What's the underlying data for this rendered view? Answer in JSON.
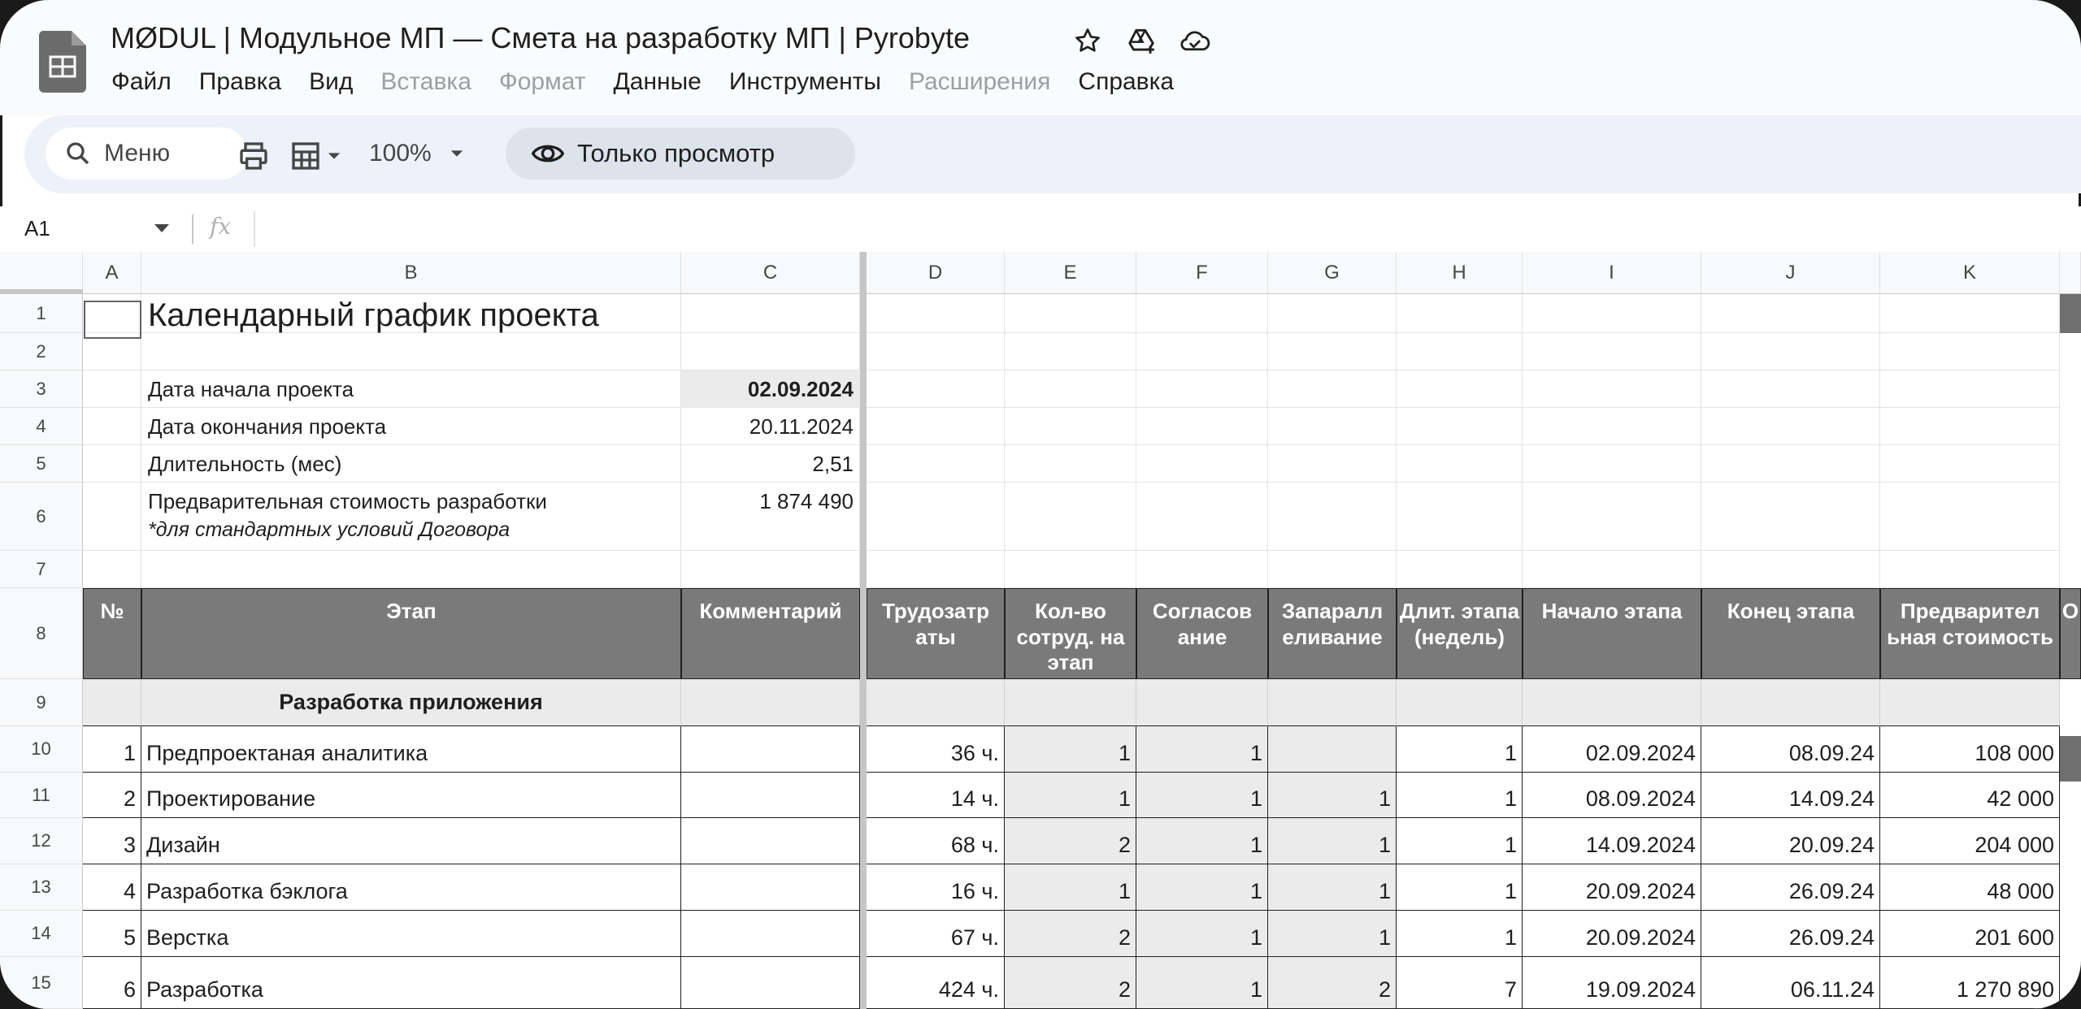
{
  "header": {
    "doc_title": "MØDUL | Модульное МП — Смета на разработку МП | Pyrobyte",
    "menu": [
      {
        "label": "Файл",
        "disabled": false
      },
      {
        "label": "Правка",
        "disabled": false
      },
      {
        "label": "Вид",
        "disabled": false
      },
      {
        "label": "Вставка",
        "disabled": true
      },
      {
        "label": "Формат",
        "disabled": true
      },
      {
        "label": "Данные",
        "disabled": false
      },
      {
        "label": "Инструменты",
        "disabled": false
      },
      {
        "label": "Расширения",
        "disabled": true
      },
      {
        "label": "Справка",
        "disabled": false
      }
    ]
  },
  "toolbar": {
    "search_label": "Меню",
    "zoom": "100%",
    "view_mode": "Только просмотр"
  },
  "formula_bar": {
    "cell_ref": "A1",
    "fx": "fx",
    "value": ""
  },
  "columns": [
    "A",
    "B",
    "C",
    "D",
    "E",
    "F",
    "G",
    "H",
    "I",
    "J",
    "K"
  ],
  "rows": [
    "1",
    "2",
    "3",
    "4",
    "5",
    "6",
    "7",
    "8",
    "9",
    "10",
    "11",
    "12",
    "13",
    "14",
    "15"
  ],
  "sheet": {
    "title": "Календарный график проекта",
    "info": [
      {
        "label": "Дата начала проекта",
        "value": "02.09.2024"
      },
      {
        "label": "Дата окончания проекта",
        "value": "20.11.2024"
      },
      {
        "label": "Длительность (мес)",
        "value": "2,51"
      },
      {
        "label": "Предварительная стоимость разработки",
        "value": "1 874 490"
      }
    ],
    "info_note": "*для стандартных условий Договора",
    "table_headers": {
      "num": "№",
      "stage": "Этап",
      "comment": "Комментарий",
      "labor": "Трудозатр аты",
      "staff": "Кол-во сотруд. на этап",
      "approval": "Согласов ание",
      "parallel": "Запаралл еливание",
      "duration": "Длит. этапа (недель)",
      "start": "Начало этапа",
      "end": "Конец этапа",
      "cost": "Предварител ьная стоимость",
      "next": "О"
    },
    "section_title": "Разработка приложения",
    "stages": [
      {
        "n": "1",
        "name": "Предпроектаная аналитика",
        "labor": "36 ч.",
        "staff": "1",
        "approval": "1",
        "parallel": "",
        "duration": "1",
        "start": "02.09.2024",
        "end": "08.09.24",
        "cost": "108 000"
      },
      {
        "n": "2",
        "name": "Проектирование",
        "labor": "14 ч.",
        "staff": "1",
        "approval": "1",
        "parallel": "1",
        "duration": "1",
        "start": "08.09.2024",
        "end": "14.09.24",
        "cost": "42 000"
      },
      {
        "n": "3",
        "name": "Дизайн",
        "labor": "68 ч.",
        "staff": "2",
        "approval": "1",
        "parallel": "1",
        "duration": "1",
        "start": "14.09.2024",
        "end": "20.09.24",
        "cost": "204 000"
      },
      {
        "n": "4",
        "name": "Разработка бэклога",
        "labor": "16 ч.",
        "staff": "1",
        "approval": "1",
        "parallel": "1",
        "duration": "1",
        "start": "20.09.2024",
        "end": "26.09.24",
        "cost": "48 000"
      },
      {
        "n": "5",
        "name": "Верстка",
        "labor": "67 ч.",
        "staff": "2",
        "approval": "1",
        "parallel": "1",
        "duration": "1",
        "start": "20.09.2024",
        "end": "26.09.24",
        "cost": "201 600"
      },
      {
        "n": "6",
        "name": "Разработка",
        "labor": "424 ч.",
        "staff": "2",
        "approval": "1",
        "parallel": "2",
        "duration": "7",
        "start": "19.09.2024",
        "end": "06.11.24",
        "cost": "1 270 890"
      }
    ]
  },
  "colors": {
    "header_bg": "#7a7a7a",
    "section_bg": "#ebebeb",
    "toolbar_bg": "#edf2fa",
    "view_pill_bg": "#dde3ea"
  },
  "icons": [
    "sheets-logo-icon",
    "star-icon",
    "drive-move-icon",
    "cloud-status-icon",
    "search-icon",
    "print-icon",
    "paint-format-icon",
    "chevron-down-icon",
    "eye-icon"
  ]
}
